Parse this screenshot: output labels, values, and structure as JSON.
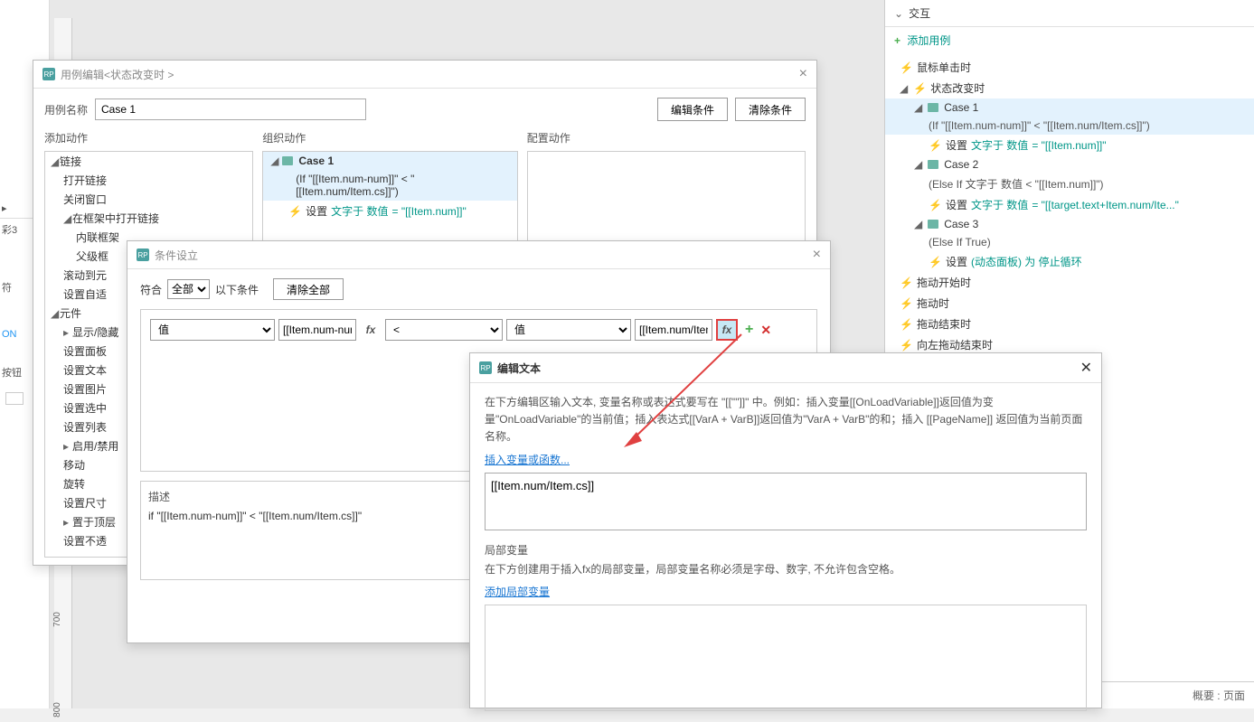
{
  "left_frag": [
    "彩3",
    "符",
    "ON",
    "按钮"
  ],
  "ruler": {
    "v_marks": [
      700,
      800
    ]
  },
  "case_editor": {
    "title": "用例编辑<状态改变时 >",
    "name_label": "用例名称",
    "name_value": "Case 1",
    "btn_edit_cond": "编辑条件",
    "btn_clear_cond": "清除条件",
    "col_add": "添加动作",
    "col_org": "组织动作",
    "col_cfg": "配置动作",
    "actions_tree": {
      "links": {
        "label": "链接",
        "items": [
          "打开链接",
          "关闭窗口",
          "在框架中打开链接",
          "内联框架",
          "父级框",
          "滚动到元",
          "设置自适"
        ]
      },
      "widgets": {
        "label": "元件",
        "items": [
          "显示/隐藏",
          "设置面板",
          "设置文本",
          "设置图片",
          "设置选中",
          "设置列表",
          "启用/禁用",
          "移动",
          "旋转",
          "设置尺寸",
          "置于顶层",
          "设置不透"
        ]
      }
    },
    "org_case": {
      "name": "Case 1",
      "cond": "(If \"[[Item.num-num]]\" < \"[[Item.num/Item.cs]]\")",
      "action_prefix": "设置 ",
      "action_mid": "文字于 数值",
      "action_val": " = \"[[Item.num]]\""
    }
  },
  "cond_dialog": {
    "title": "条件设立",
    "match_label": "符合",
    "match_value": "全部",
    "suffix": "以下条件",
    "btn_clear": "清除全部",
    "row": {
      "type1": "值",
      "val1": "[[Item.num-num]]",
      "op": "<",
      "type2": "值",
      "val2": "[[Item.num/Item.cs"
    },
    "desc_label": "描述",
    "desc_text": "if \"[[Item.num-num]]\" < \"[[Item.num/Item.cs]]\""
  },
  "edit_dialog": {
    "title": "编辑文本",
    "hint": "在下方编辑区输入文本, 变量名称或表达式要写在 \"[[\"\"]]\" 中。例如：插入变量[[OnLoadVariable]]返回值为变量\"OnLoadVariable\"的当前值；插入表达式[[VarA + VarB]]返回值为\"VarA + VarB\"的和；插入 [[PageName]] 返回值为当前页面名称。",
    "link_insert": "插入变量或函数...",
    "text_value": "[[Item.num/Item.cs]]",
    "local_label": "局部变量",
    "local_hint": "在下方创建用于插入fx的局部变量，局部变量名称必须是字母、数字, 不允许包含空格。",
    "link_add_local": "添加局部变量"
  },
  "right": {
    "title": "交互",
    "add_case": "添加用例",
    "footer_left": "概要",
    "footer_right": "页面",
    "events": [
      {
        "label": "鼠标单击时",
        "lv": 1,
        "icon": "ev"
      },
      {
        "label": "状态改变时",
        "lv": 1,
        "icon": "ev",
        "exp": true,
        "children": [
          {
            "label": "Case 1",
            "lv": 2,
            "icon": "case",
            "sel": true,
            "cond": "(If \"[[Item.num-num]]\" < \"[[Item.num/Item.cs]]\")",
            "children": [
              {
                "label_pre": "设置 ",
                "label_mid": "文字于 数值",
                "label_val": " = \"[[Item.num]]\"",
                "lv": 3,
                "icon": "bolt"
              }
            ]
          },
          {
            "label": "Case 2",
            "lv": 2,
            "icon": "case",
            "cond": "(Else If 文字于 数值 < \"[[Item.num]]\")",
            "children": [
              {
                "label_pre": "设置 ",
                "label_mid": "文字于 数值",
                "label_val": " = \"[[target.text+Item.num/Ite...\"",
                "lv": 3,
                "icon": "bolt"
              }
            ]
          },
          {
            "label": "Case 3",
            "lv": 2,
            "icon": "case",
            "cond": "(Else If True)",
            "children": [
              {
                "label_pre": "设置 ",
                "label_mid": "(动态面板) 为 停止循环",
                "label_val": "",
                "lv": 3,
                "icon": "bolt"
              }
            ]
          }
        ]
      },
      {
        "label": "拖动开始时",
        "lv": 1,
        "icon": "ev"
      },
      {
        "label": "拖动时",
        "lv": 1,
        "icon": "ev"
      },
      {
        "label": "拖动结束时",
        "lv": 1,
        "icon": "ev"
      },
      {
        "label": "向左拖动结束时",
        "lv": 1,
        "icon": "ev"
      }
    ]
  }
}
